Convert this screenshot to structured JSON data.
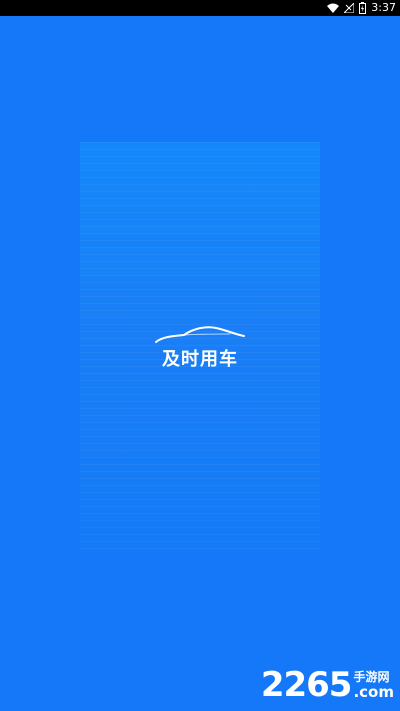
{
  "status_bar": {
    "time": "3:37",
    "icons": [
      "wifi-icon",
      "signal-off-icon",
      "battery-icon"
    ]
  },
  "splash": {
    "app_name": "及时用车",
    "logo_icon": "car-silhouette-icon"
  },
  "watermark": {
    "number": "2265",
    "site_cn": "手游网",
    "domain_suffix": ".com"
  },
  "colors": {
    "background": "#1478f8",
    "card_top": "#1488fa",
    "card_bottom": "#147af6",
    "text": "#ffffff",
    "status_bar": "#000000"
  }
}
